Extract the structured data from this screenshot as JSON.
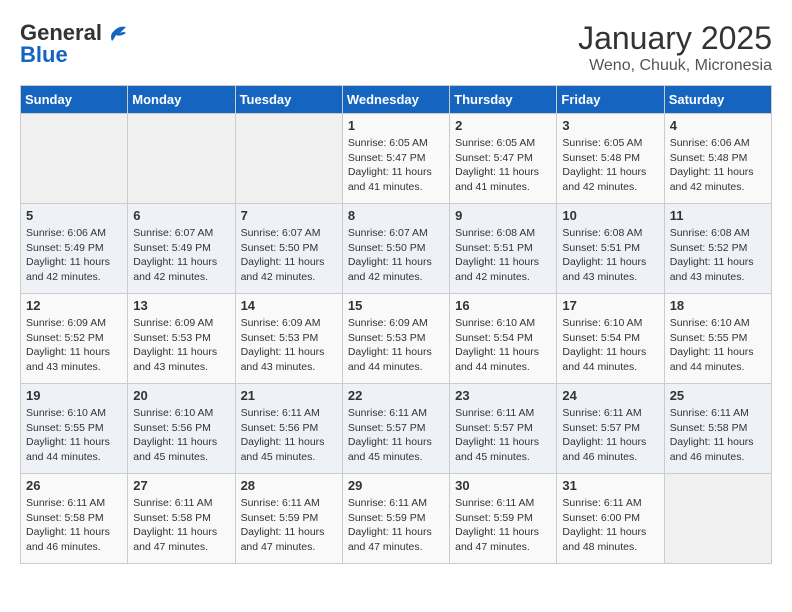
{
  "header": {
    "logo_general": "General",
    "logo_blue": "Blue",
    "month_title": "January 2025",
    "location": "Weno, Chuuk, Micronesia"
  },
  "days_of_week": [
    "Sunday",
    "Monday",
    "Tuesday",
    "Wednesday",
    "Thursday",
    "Friday",
    "Saturday"
  ],
  "weeks": [
    [
      {
        "day": "",
        "sunrise": "",
        "sunset": "",
        "daylight": ""
      },
      {
        "day": "",
        "sunrise": "",
        "sunset": "",
        "daylight": ""
      },
      {
        "day": "",
        "sunrise": "",
        "sunset": "",
        "daylight": ""
      },
      {
        "day": "1",
        "sunrise": "Sunrise: 6:05 AM",
        "sunset": "Sunset: 5:47 PM",
        "daylight": "Daylight: 11 hours and 41 minutes."
      },
      {
        "day": "2",
        "sunrise": "Sunrise: 6:05 AM",
        "sunset": "Sunset: 5:47 PM",
        "daylight": "Daylight: 11 hours and 41 minutes."
      },
      {
        "day": "3",
        "sunrise": "Sunrise: 6:05 AM",
        "sunset": "Sunset: 5:48 PM",
        "daylight": "Daylight: 11 hours and 42 minutes."
      },
      {
        "day": "4",
        "sunrise": "Sunrise: 6:06 AM",
        "sunset": "Sunset: 5:48 PM",
        "daylight": "Daylight: 11 hours and 42 minutes."
      }
    ],
    [
      {
        "day": "5",
        "sunrise": "Sunrise: 6:06 AM",
        "sunset": "Sunset: 5:49 PM",
        "daylight": "Daylight: 11 hours and 42 minutes."
      },
      {
        "day": "6",
        "sunrise": "Sunrise: 6:07 AM",
        "sunset": "Sunset: 5:49 PM",
        "daylight": "Daylight: 11 hours and 42 minutes."
      },
      {
        "day": "7",
        "sunrise": "Sunrise: 6:07 AM",
        "sunset": "Sunset: 5:50 PM",
        "daylight": "Daylight: 11 hours and 42 minutes."
      },
      {
        "day": "8",
        "sunrise": "Sunrise: 6:07 AM",
        "sunset": "Sunset: 5:50 PM",
        "daylight": "Daylight: 11 hours and 42 minutes."
      },
      {
        "day": "9",
        "sunrise": "Sunrise: 6:08 AM",
        "sunset": "Sunset: 5:51 PM",
        "daylight": "Daylight: 11 hours and 42 minutes."
      },
      {
        "day": "10",
        "sunrise": "Sunrise: 6:08 AM",
        "sunset": "Sunset: 5:51 PM",
        "daylight": "Daylight: 11 hours and 43 minutes."
      },
      {
        "day": "11",
        "sunrise": "Sunrise: 6:08 AM",
        "sunset": "Sunset: 5:52 PM",
        "daylight": "Daylight: 11 hours and 43 minutes."
      }
    ],
    [
      {
        "day": "12",
        "sunrise": "Sunrise: 6:09 AM",
        "sunset": "Sunset: 5:52 PM",
        "daylight": "Daylight: 11 hours and 43 minutes."
      },
      {
        "day": "13",
        "sunrise": "Sunrise: 6:09 AM",
        "sunset": "Sunset: 5:53 PM",
        "daylight": "Daylight: 11 hours and 43 minutes."
      },
      {
        "day": "14",
        "sunrise": "Sunrise: 6:09 AM",
        "sunset": "Sunset: 5:53 PM",
        "daylight": "Daylight: 11 hours and 43 minutes."
      },
      {
        "day": "15",
        "sunrise": "Sunrise: 6:09 AM",
        "sunset": "Sunset: 5:53 PM",
        "daylight": "Daylight: 11 hours and 44 minutes."
      },
      {
        "day": "16",
        "sunrise": "Sunrise: 6:10 AM",
        "sunset": "Sunset: 5:54 PM",
        "daylight": "Daylight: 11 hours and 44 minutes."
      },
      {
        "day": "17",
        "sunrise": "Sunrise: 6:10 AM",
        "sunset": "Sunset: 5:54 PM",
        "daylight": "Daylight: 11 hours and 44 minutes."
      },
      {
        "day": "18",
        "sunrise": "Sunrise: 6:10 AM",
        "sunset": "Sunset: 5:55 PM",
        "daylight": "Daylight: 11 hours and 44 minutes."
      }
    ],
    [
      {
        "day": "19",
        "sunrise": "Sunrise: 6:10 AM",
        "sunset": "Sunset: 5:55 PM",
        "daylight": "Daylight: 11 hours and 44 minutes."
      },
      {
        "day": "20",
        "sunrise": "Sunrise: 6:10 AM",
        "sunset": "Sunset: 5:56 PM",
        "daylight": "Daylight: 11 hours and 45 minutes."
      },
      {
        "day": "21",
        "sunrise": "Sunrise: 6:11 AM",
        "sunset": "Sunset: 5:56 PM",
        "daylight": "Daylight: 11 hours and 45 minutes."
      },
      {
        "day": "22",
        "sunrise": "Sunrise: 6:11 AM",
        "sunset": "Sunset: 5:57 PM",
        "daylight": "Daylight: 11 hours and 45 minutes."
      },
      {
        "day": "23",
        "sunrise": "Sunrise: 6:11 AM",
        "sunset": "Sunset: 5:57 PM",
        "daylight": "Daylight: 11 hours and 45 minutes."
      },
      {
        "day": "24",
        "sunrise": "Sunrise: 6:11 AM",
        "sunset": "Sunset: 5:57 PM",
        "daylight": "Daylight: 11 hours and 46 minutes."
      },
      {
        "day": "25",
        "sunrise": "Sunrise: 6:11 AM",
        "sunset": "Sunset: 5:58 PM",
        "daylight": "Daylight: 11 hours and 46 minutes."
      }
    ],
    [
      {
        "day": "26",
        "sunrise": "Sunrise: 6:11 AM",
        "sunset": "Sunset: 5:58 PM",
        "daylight": "Daylight: 11 hours and 46 minutes."
      },
      {
        "day": "27",
        "sunrise": "Sunrise: 6:11 AM",
        "sunset": "Sunset: 5:58 PM",
        "daylight": "Daylight: 11 hours and 47 minutes."
      },
      {
        "day": "28",
        "sunrise": "Sunrise: 6:11 AM",
        "sunset": "Sunset: 5:59 PM",
        "daylight": "Daylight: 11 hours and 47 minutes."
      },
      {
        "day": "29",
        "sunrise": "Sunrise: 6:11 AM",
        "sunset": "Sunset: 5:59 PM",
        "daylight": "Daylight: 11 hours and 47 minutes."
      },
      {
        "day": "30",
        "sunrise": "Sunrise: 6:11 AM",
        "sunset": "Sunset: 5:59 PM",
        "daylight": "Daylight: 11 hours and 47 minutes."
      },
      {
        "day": "31",
        "sunrise": "Sunrise: 6:11 AM",
        "sunset": "Sunset: 6:00 PM",
        "daylight": "Daylight: 11 hours and 48 minutes."
      },
      {
        "day": "",
        "sunrise": "",
        "sunset": "",
        "daylight": ""
      }
    ]
  ]
}
